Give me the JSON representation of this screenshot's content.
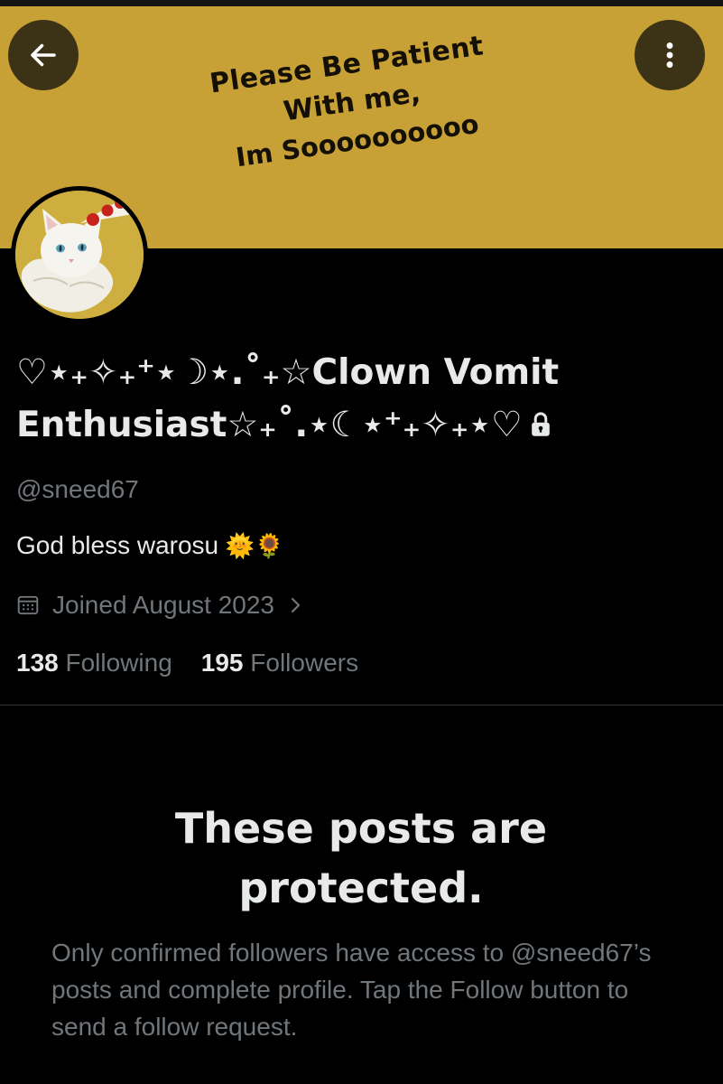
{
  "banner": {
    "line1": "Please Be Patient",
    "line2": "With me,",
    "line3": "Im Soooooooooo",
    "color": "#c8a136"
  },
  "navigation": {
    "back_icon": "arrow-left-icon",
    "more_icon": "more-vertical-icon"
  },
  "profile": {
    "display_name": "♡⋆₊✧₊⁺⋆☽⋆.˚₊☆Clown Vomit Enthusiast☆₊˚.⋆☾⋆⁺₊✧₊⋆♡",
    "lock_icon": "lock-icon",
    "handle": "@sneed67",
    "bio_text": "God bless warosu",
    "bio_emojis": "🌞🌻",
    "joined": "Joined August 2023",
    "joined_icon": "calendar-icon",
    "following_count": "138",
    "following_label": "Following",
    "followers_count": "195",
    "followers_label": "Followers"
  },
  "protected": {
    "title": "These posts are protected.",
    "message": "Only confirmed followers have access to @sneed67’s posts and complete profile. Tap the Follow button to send a follow request."
  }
}
